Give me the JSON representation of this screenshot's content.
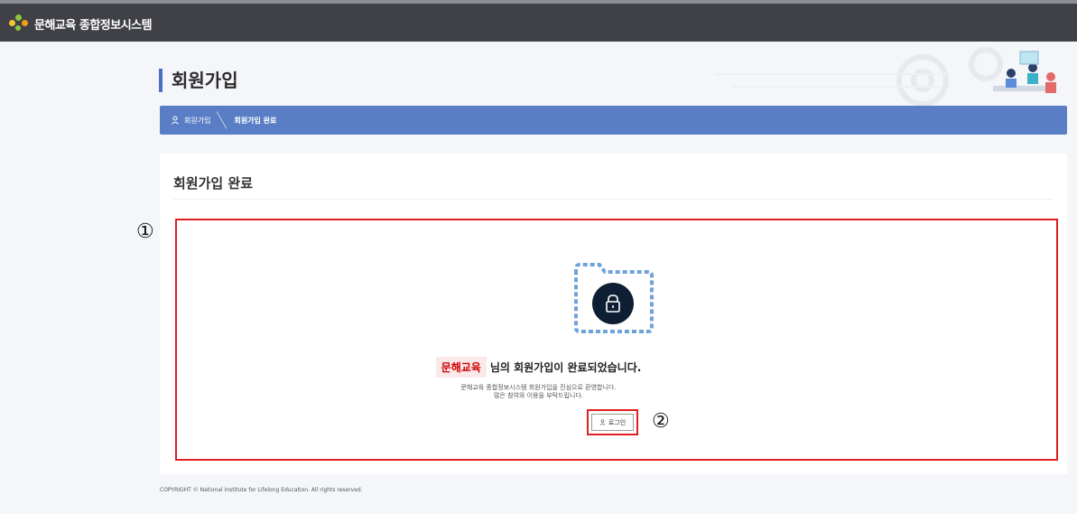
{
  "header": {
    "brand_title": "문해교육 종합정보시스템",
    "bar_color": "#3f4147"
  },
  "page": {
    "title": "회원가입"
  },
  "breadcrumb": {
    "items": [
      "회원가입",
      "회원가입 완료"
    ],
    "color": "#5a7ec6"
  },
  "panel": {
    "title": "회원가입 완료"
  },
  "message": {
    "user_name": "문해교육",
    "main_text": "님의 회원가입이 완료되었습니다.",
    "sub_line1": "문해교육 종합정보시스템 회원가입을 진심으로 환영합니다.",
    "sub_line2": "많은 참여와 이용을 부탁드립니다."
  },
  "login_button": {
    "label": "로그인"
  },
  "annotations": {
    "marker1": "①",
    "marker2": "②",
    "color": "#e02020"
  },
  "icons": [
    "person-icon",
    "lock-icon",
    "folder-icon",
    "logo-icon"
  ],
  "footer": {
    "copyright": "COPYRIGHT © National Institute for Lifelong Education. All rights reserved."
  }
}
